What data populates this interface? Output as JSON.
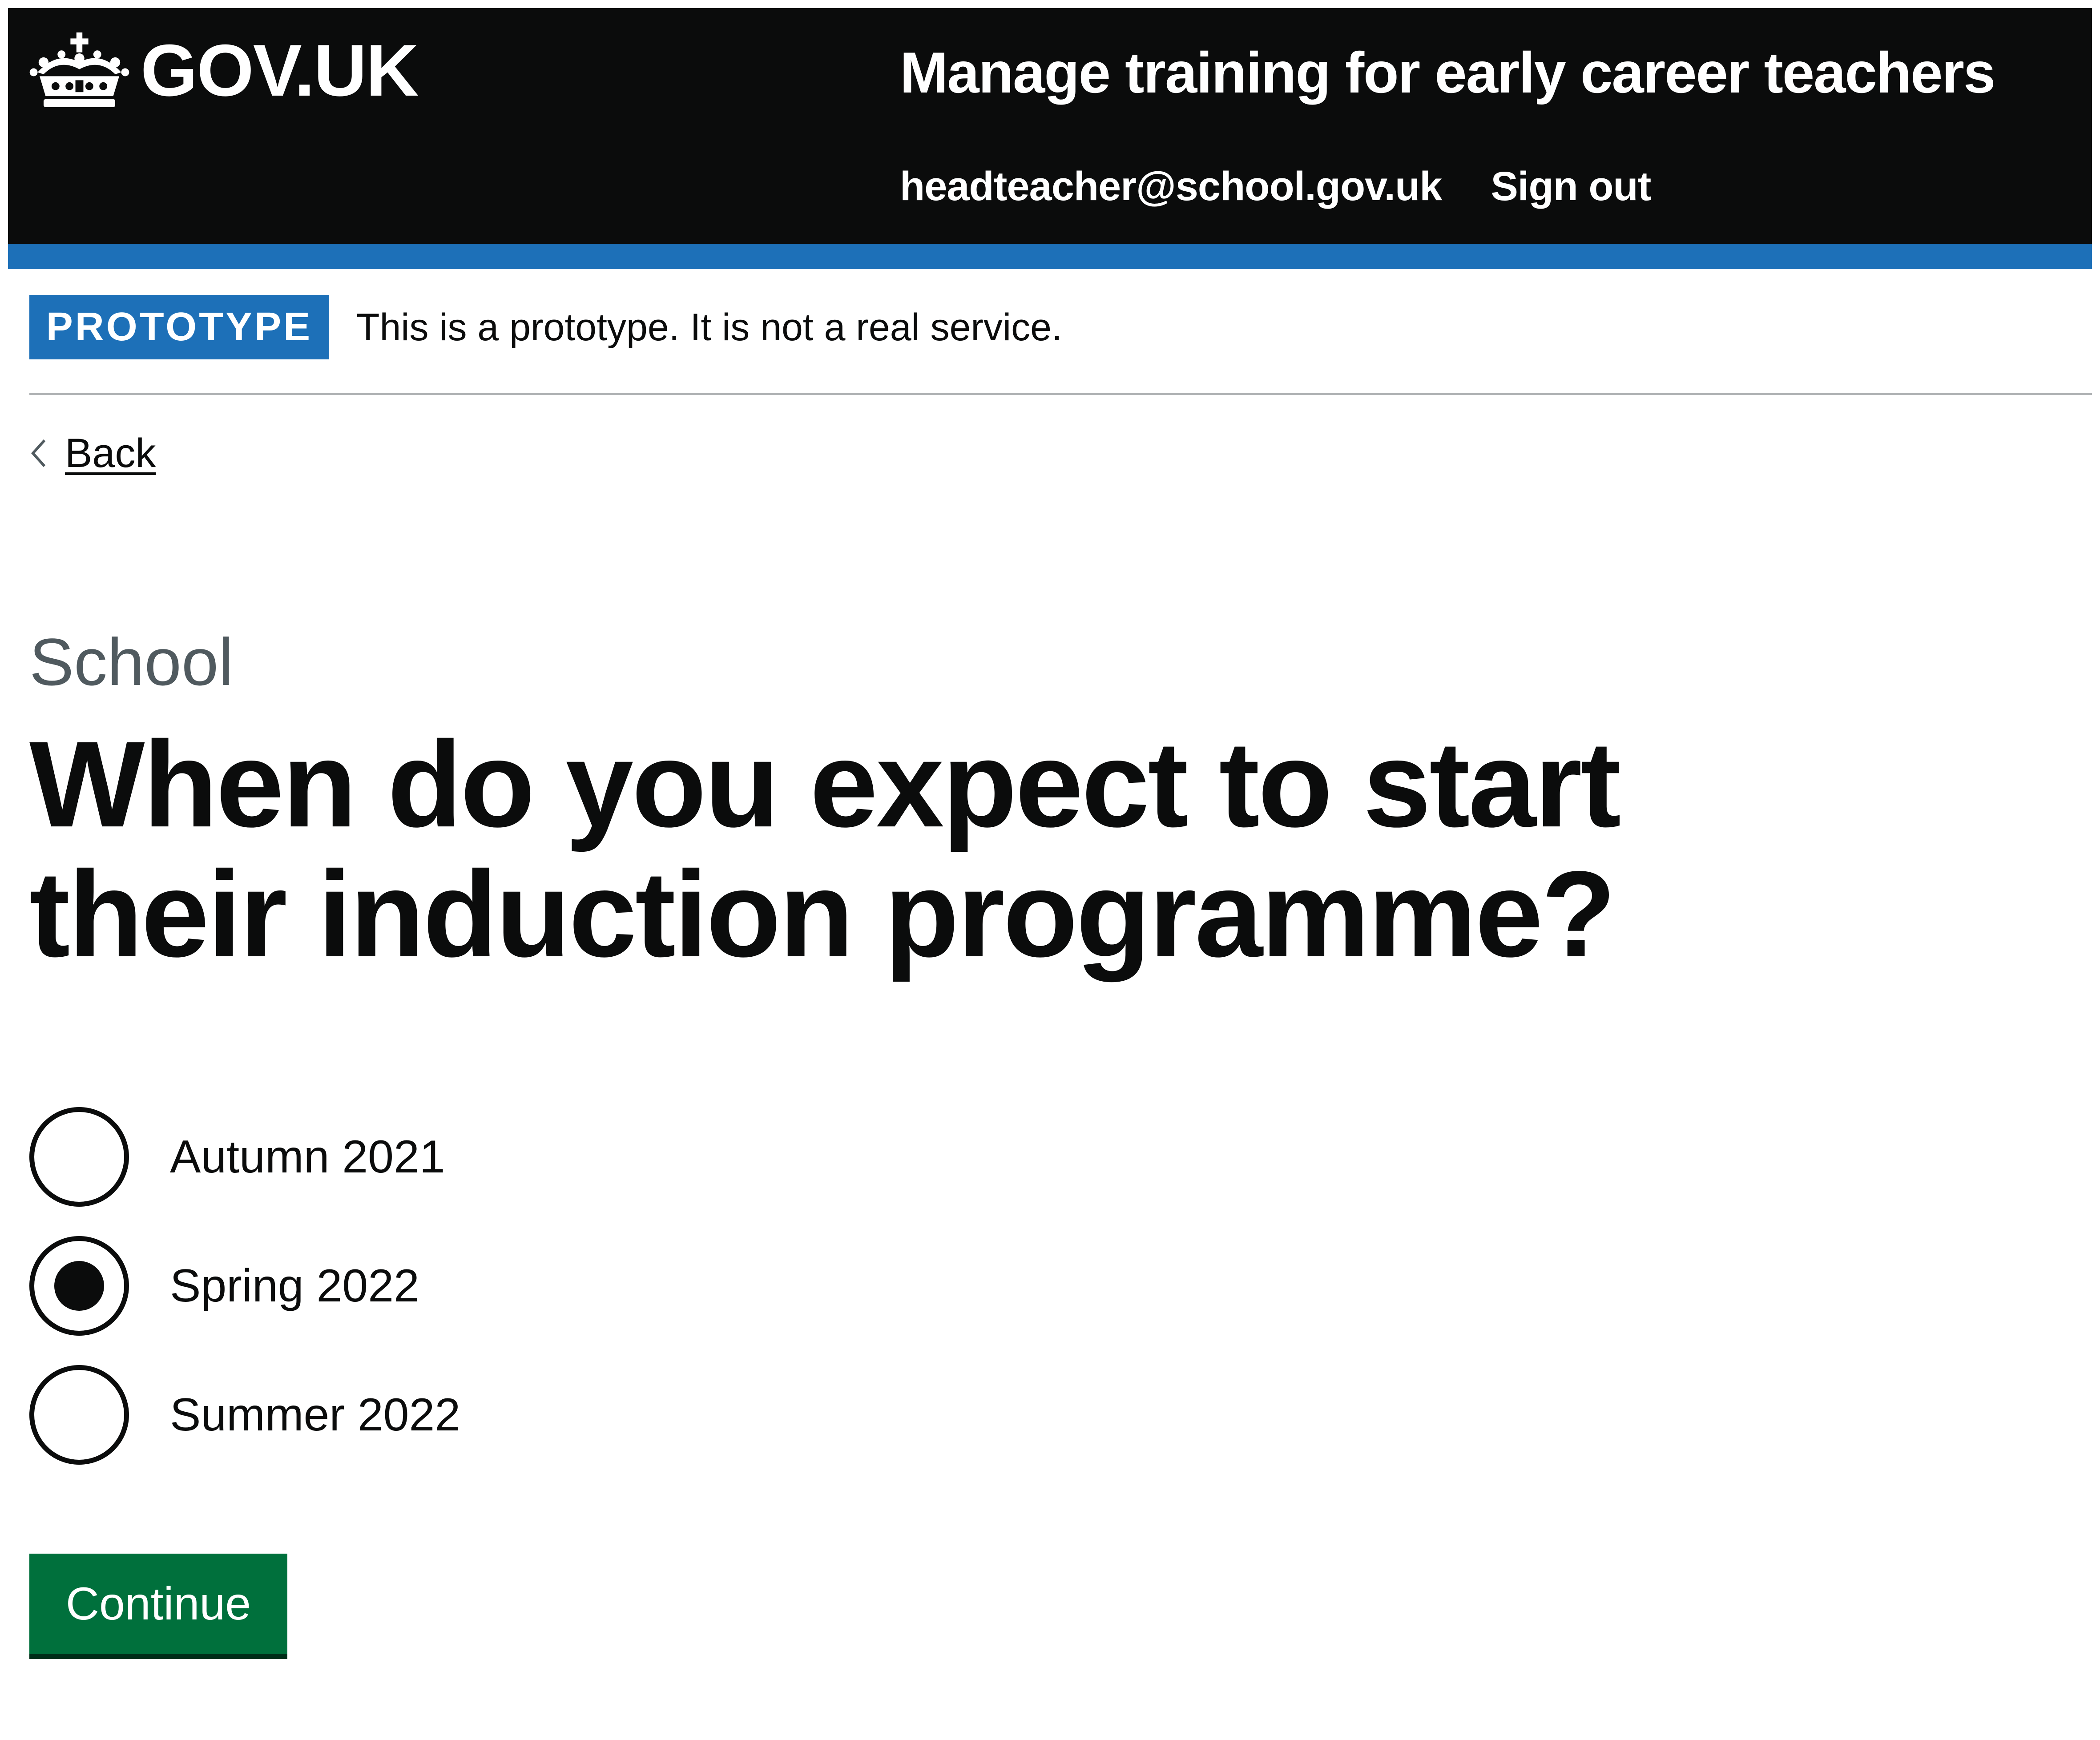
{
  "header": {
    "logo_text": "GOV.UK",
    "service_name": "Manage training for early career teachers",
    "nav": {
      "user_email": "headteacher@school.gov.uk",
      "sign_out": "Sign out"
    }
  },
  "phase_banner": {
    "tag": "PROTOTYPE",
    "text": "This is a prototype. It is not a real service."
  },
  "back_link": {
    "label": "Back"
  },
  "main": {
    "caption": "School",
    "heading": "When do you expect to start their induction programme?",
    "radios": [
      {
        "label": "Autumn 2021",
        "checked": false
      },
      {
        "label": "Spring 2022",
        "checked": true
      },
      {
        "label": "Summer 2022",
        "checked": false
      }
    ],
    "continue_label": "Continue"
  },
  "colors": {
    "header_background": "#0b0c0c",
    "brand_blue": "#1d70b8",
    "button_green": "#00703c",
    "caption_grey": "#505a5f"
  },
  "icons": {
    "logo": "crown-icon",
    "back": "chevron-left-icon"
  }
}
